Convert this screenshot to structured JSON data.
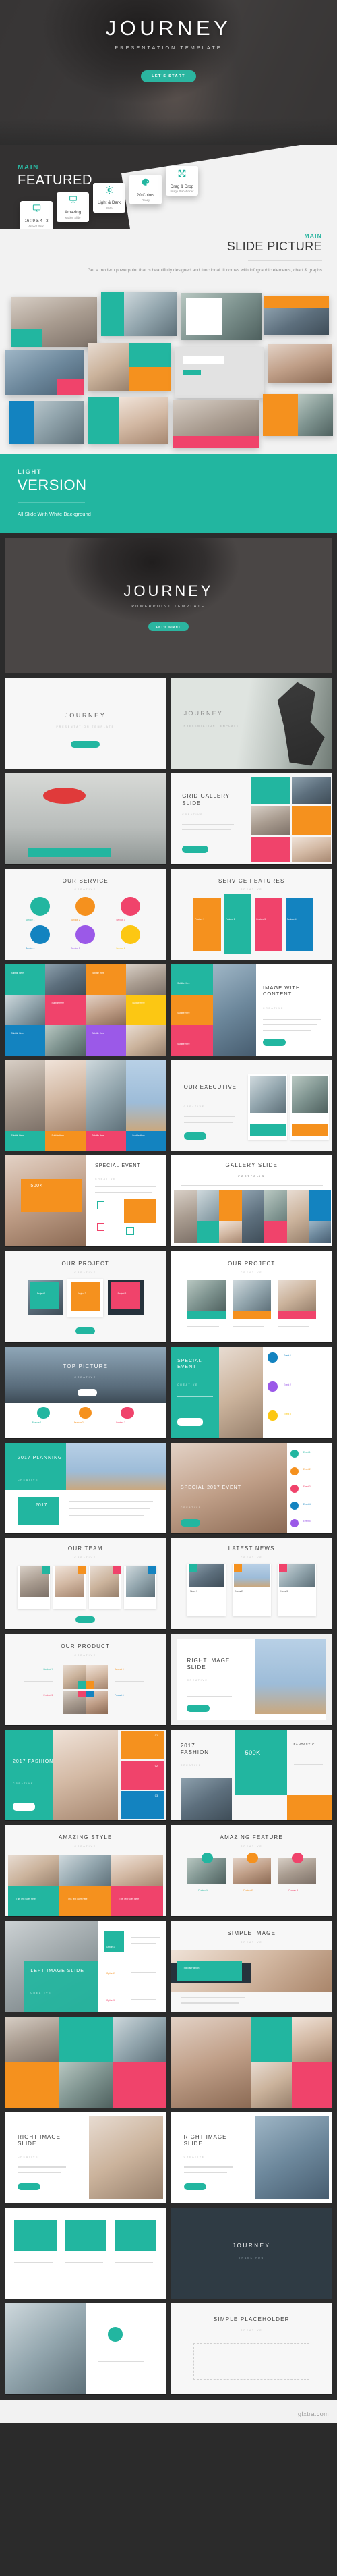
{
  "hero": {
    "title": "JOURNEY",
    "subtitle": "PRESENTATION TEMPLATE",
    "button": "LET'S START"
  },
  "featured": {
    "eyebrow": "MAIN",
    "heading": "FEATURED",
    "cards": [
      {
        "icon": "monitor-icon",
        "title": "16 : 9 & 4 : 3",
        "subtitle": "Aspect Ratio"
      },
      {
        "icon": "presentation-icon",
        "title": "Amazing",
        "subtitle": "Motion Slide"
      },
      {
        "icon": "brightness-icon",
        "title": "Light & Dark",
        "subtitle": "Slide"
      },
      {
        "icon": "palette-icon",
        "title": "20 Colors",
        "subtitle": "Ready"
      },
      {
        "icon": "drag-drop-icon",
        "title": "Drag & Drop",
        "subtitle": "Image Placeholder"
      }
    ]
  },
  "slide_picture": {
    "eyebrow": "MAIN",
    "heading": "SLIDE PICTURE",
    "paragraph": "Get a modern powerpoint that is beautifully designed and functional. It comes with infographic elements, chart & graphs"
  },
  "light_version": {
    "eyebrow": "LIGHT",
    "heading": "VERSION",
    "paragraph": "All Slide With White Background"
  },
  "big_photo": {
    "title": "JOURNEY",
    "subtitle": "POWERPOINT TEMPLATE",
    "button": "LET'S START"
  },
  "slides": [
    {
      "title": "JOURNEY",
      "subtitle": "PRESENTATION TEMPLATE",
      "layout": "cover-light"
    },
    {
      "title": "JOURNEY",
      "subtitle": "PRESENTATION TEMPLATE",
      "layout": "cover-photo"
    },
    {
      "title": "",
      "subtitle": "",
      "layout": "umbrella-photo"
    },
    {
      "title": "GRID GALLERY SLIDE",
      "subtitle": "CREATIVE",
      "layout": "grid-gallery"
    },
    {
      "title": "OUR SERVICE",
      "subtitle": "CREATIVE",
      "layout": "service-icons"
    },
    {
      "title": "SERVICE FEATURES",
      "subtitle": "CREATIVE",
      "layout": "feature-columns"
    },
    {
      "title": "",
      "subtitle": "",
      "layout": "mosaic-3x4"
    },
    {
      "title": "IMAGE WITH CONTENT",
      "subtitle": "CREATIVE",
      "layout": "image-with-content"
    },
    {
      "title": "",
      "subtitle": "",
      "layout": "four-photo-caption"
    },
    {
      "title": "OUR EXECUTIVE",
      "subtitle": "CREATIVE",
      "layout": "executive"
    },
    {
      "title": "SPECIAL EVENT",
      "subtitle": "CREATIVE",
      "layout": "special-event-500k"
    },
    {
      "title": "GALLERY SLIDE",
      "subtitle": "PORTFOLIO",
      "layout": "gallery-strip"
    },
    {
      "title": "OUR PROJECT",
      "subtitle": "CREATIVE",
      "layout": "project-cards"
    },
    {
      "title": "OUR PROJECT",
      "subtitle": "CREATIVE",
      "layout": "project-photos"
    },
    {
      "title": "TOP PICTURE",
      "subtitle": "CREATIVE",
      "layout": "top-picture"
    },
    {
      "title": "SPECIAL EVENT",
      "subtitle": "CREATIVE",
      "layout": "special-event-list"
    },
    {
      "title": "2017 PLANNING",
      "subtitle": "CREATIVE",
      "layout": "planning-2017"
    },
    {
      "title": "SPECIAL 2017 EVENT",
      "subtitle": "CREATIVE",
      "layout": "special-2017"
    },
    {
      "title": "OUR TEAM",
      "subtitle": "CREATIVE",
      "layout": "team"
    },
    {
      "title": "LATEST NEWS",
      "subtitle": "CREATIVE",
      "layout": "news"
    },
    {
      "title": "OUR PRODUCT",
      "subtitle": "CREATIVE",
      "layout": "product-grid"
    },
    {
      "title": "RIGHT IMAGE SLIDE",
      "subtitle": "CREATIVE",
      "layout": "right-image"
    },
    {
      "title": "2017 FASHION",
      "subtitle": "CREATIVE",
      "layout": "fashion-numbers"
    },
    {
      "title": "2017 FASHION",
      "subtitle": "CREATIVE",
      "layout": "fashion-500k"
    },
    {
      "title": "AMAZING STYLE",
      "subtitle": "CREATIVE",
      "layout": "amazing-style"
    },
    {
      "title": "AMAZING FEATURE",
      "subtitle": "CREATIVE",
      "layout": "amazing-feature"
    },
    {
      "title": "LEFT IMAGE SLIDE",
      "subtitle": "CREATIVE",
      "layout": "left-image"
    },
    {
      "title": "SIMPLE IMAGE",
      "subtitle": "CREATIVE",
      "layout": "simple-image"
    },
    {
      "title": "",
      "subtitle": "",
      "layout": "photo-mosaic-a"
    },
    {
      "title": "",
      "subtitle": "",
      "layout": "photo-mosaic-b"
    },
    {
      "title": "RIGHT IMAGE SLIDE",
      "subtitle": "CREATIVE",
      "layout": "right-image-2"
    },
    {
      "title": "RIGHT IMAGE SLIDE",
      "subtitle": "CREATIVE",
      "layout": "right-image-3"
    },
    {
      "title": "",
      "subtitle": "",
      "layout": "teal-cards"
    },
    {
      "title": "JOURNEY",
      "subtitle": "THANK YOU",
      "layout": "closing"
    },
    {
      "title": "",
      "subtitle": "",
      "layout": "mosaic-end"
    },
    {
      "title": "SIMPLE PLACEHOLDER",
      "subtitle": "CREATIVE",
      "layout": "simple-placeholder"
    }
  ],
  "slide_labels": {
    "project_1": "Project 1",
    "project_2": "Project 2",
    "project_3": "Project 3",
    "service_1": "Service 1",
    "service_2": "Service 2",
    "service_3": "Service 3",
    "service_4": "Service 4",
    "service_5": "Service 5",
    "service_6": "Service 6",
    "feature_1": "Feature 1",
    "feature_2": "Feature 2",
    "feature_3": "Feature 3",
    "feature_4": "Feature 4",
    "product_1": "Product 1",
    "product_2": "Product 2",
    "product_3": "Product 3",
    "product_4": "Product 4",
    "event_1": "Event 1",
    "event_2": "Event 2",
    "event_3": "Event 3",
    "event_4": "Event 4",
    "event_5": "Event 5",
    "news_1": "News 1",
    "news_2": "News 2",
    "news_3": "News 3",
    "subtitle_here": "Subtitle Here",
    "title_text_goes_here": "This Text Goes Here",
    "picture_1": "Picture 1",
    "picture_2": "Picture 2",
    "picture_3": "Picture 3",
    "number_01": "01",
    "number_02": "02",
    "number_03": "03",
    "stat_500k": "500K",
    "fantastic": "FANTASTIC",
    "year_2017": "2017",
    "special_fashion": "Special Fashion",
    "option_1": "Option 1",
    "option_2": "Option 2",
    "option_3": "Option 3",
    "read_more": "READ MORE",
    "our_product": "OUR PRODUCT",
    "lorem_caps": "LOREM IPSUM DOLOR SIT AMET PUT ANY THING"
  },
  "colors": {
    "accent_teal": "#22b6a0",
    "orange": "#f5911e",
    "pink": "#f0436b",
    "blue": "#1383c0",
    "purple": "#9b59e8",
    "yellow": "#fcc713",
    "dark": "#2b2b2b",
    "light_bg": "#f2f2f2"
  },
  "watermark": "gfxtra.com"
}
